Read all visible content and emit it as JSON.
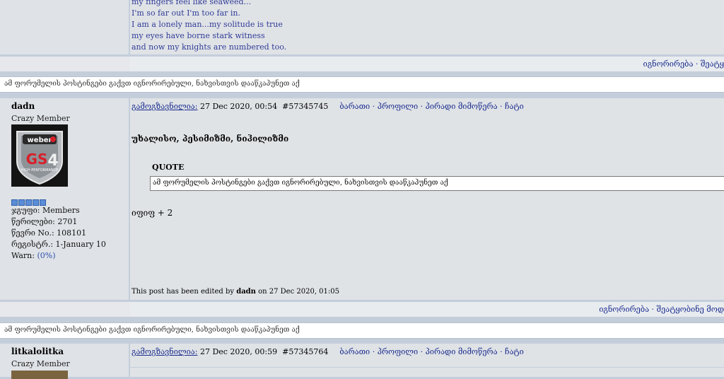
{
  "prev_post": {
    "lines": [
      "my fingers feel like seaweed...",
      "I'm so far out I'm too far in.",
      "I am a lonely man...my solitude is true",
      "my eyes have borne stark witness",
      "and now my knights are numbered too."
    ],
    "footer_links": "იგნორირება · შეატყ"
  },
  "ignored_notice_1": "ამ ფორუმელის პოსტინგები გაქვთ იგნორირებული, ნახვისთვის დააწკაპუნეთ აქ",
  "post1": {
    "username": "dadn",
    "rank": "Crazy Member",
    "avatar_alt": "Weber GS4 High Performance",
    "group": "ჯგუფი: Members",
    "posts": "წერილები: 2701",
    "member_no": "წევრი No.: 108101",
    "registered": "რეგისტრ.: 1-January 10",
    "warn_label": "Warn: ",
    "warn_value": "(0%)",
    "sent_label": "გამოგზავნილია:",
    "date": " 27 Dec 2020, 00:54",
    "post_id": "#57345745",
    "header_links": "ბარათი · პროფილი · პირადი მიმოწერა · ჩატი",
    "title": "უხალისო, პესიმიზმი, ნიჰილიზმი",
    "quote_label": "QUOTE",
    "quote_text": "ამ ფორუმელის პოსტინგები გაქვთ იგნორირებული, ნახვისთვის დააწკაპუნეთ აქ",
    "body_text": "იფიფ + 2",
    "edited_prefix": "This post has been edited by ",
    "edited_user": "dadn",
    "edited_suffix": " on 27 Dec 2020, 01:05",
    "footer_links": "იგნორირება · შეატყობინე მოდ"
  },
  "ignored_notice_2": "ამ ფორუმელის პოსტინგები გაქვთ იგნორირებული, ნახვისთვის დააწკაპუნეთ აქ",
  "post2": {
    "username": "litkalolitka",
    "rank": "Crazy Member",
    "sent_label": "გამოგზავნილია:",
    "date": " 27 Dec 2020, 00:59",
    "post_id": "#57345764",
    "header_links": "ბარათი · პროფილი · პირადი მიმოწერა · ჩატი"
  }
}
